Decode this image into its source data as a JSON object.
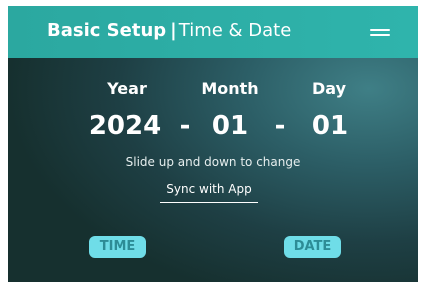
{
  "header": {
    "title_bold": "Basic Setup",
    "separator": "|",
    "title_sub": "Time & Date",
    "menu_icon": "hamburger-menu-icon"
  },
  "date_picker": {
    "year": {
      "label": "Year",
      "value": "2024"
    },
    "month": {
      "label": "Month",
      "value": "01"
    },
    "day": {
      "label": "Day",
      "value": "01"
    },
    "separator": "-"
  },
  "hint": "Slide up and down to change",
  "sync_button_label": "Sync with App",
  "mode_buttons": {
    "time_label": "TIME",
    "date_label": "DATE"
  },
  "colors": {
    "header_bg": "#2fb4ac",
    "panel_bg": "#1e3f44",
    "pill_bg": "#6fdde8",
    "pill_text": "#2d8c96"
  }
}
